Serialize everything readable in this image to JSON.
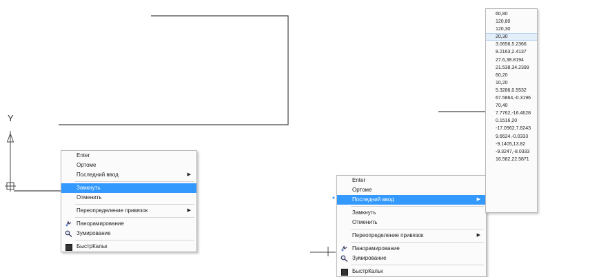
{
  "axis": {
    "y_label": "Y"
  },
  "menu_left": {
    "items": [
      {
        "label": "Enter",
        "type": "item"
      },
      {
        "label": "Ортоме",
        "type": "item"
      },
      {
        "label": "Последний ввод",
        "type": "submenu"
      },
      {
        "type": "separator"
      },
      {
        "label": "Замкнуть",
        "type": "item",
        "highlighted": true
      },
      {
        "label": "Отменить",
        "type": "item"
      },
      {
        "type": "separator"
      },
      {
        "label": "Переопределение привязок",
        "type": "submenu"
      },
      {
        "type": "separator"
      },
      {
        "label": "Панорамирование",
        "type": "item",
        "icon": "pan-icon"
      },
      {
        "label": "Зумирование",
        "type": "item",
        "icon": "zoom-icon"
      },
      {
        "type": "separator"
      },
      {
        "label": "БыстрКальк",
        "type": "item",
        "icon": "calculator-icon"
      }
    ]
  },
  "menu_right": {
    "items": [
      {
        "label": "Enter",
        "type": "item"
      },
      {
        "label": "Ортоме",
        "type": "item"
      },
      {
        "label": "Последний ввод",
        "type": "submenu",
        "highlighted": true
      },
      {
        "type": "separator"
      },
      {
        "label": "Замкнуть",
        "type": "item"
      },
      {
        "label": "Отменить",
        "type": "item"
      },
      {
        "type": "separator"
      },
      {
        "label": "Переопределение привязок",
        "type": "submenu"
      },
      {
        "type": "separator"
      },
      {
        "label": "Панорамирование",
        "type": "item",
        "icon": "pan-icon"
      },
      {
        "label": "Зумирование",
        "type": "item",
        "icon": "zoom-icon"
      },
      {
        "type": "separator"
      },
      {
        "label": "БыстрКальк",
        "type": "item",
        "icon": "calculator-icon"
      }
    ]
  },
  "last_input_submenu": {
    "highlighted_index": 3,
    "items": [
      "60,80",
      "120,80",
      "120,30",
      "20,30",
      "3.0656,5.2366",
      "8.2163,2.4137",
      "27.6,38.8194",
      "21.538,34.2399",
      "60,20",
      "10,20",
      "5.3286,0.5532",
      "67.5864,-0.3196",
      "70,40",
      "7.7762,-16.4628",
      "0.1516,20",
      "-17.0962,7.8243",
      "9.6624,-0.0333",
      "-9.1405,13.82",
      "-9.3247,-8.0333",
      "16.582,22.5871"
    ]
  },
  "colors": {
    "highlight": "#3399ff",
    "submenu_highlight": "#e3eefb",
    "drawing_line": "#444444"
  }
}
